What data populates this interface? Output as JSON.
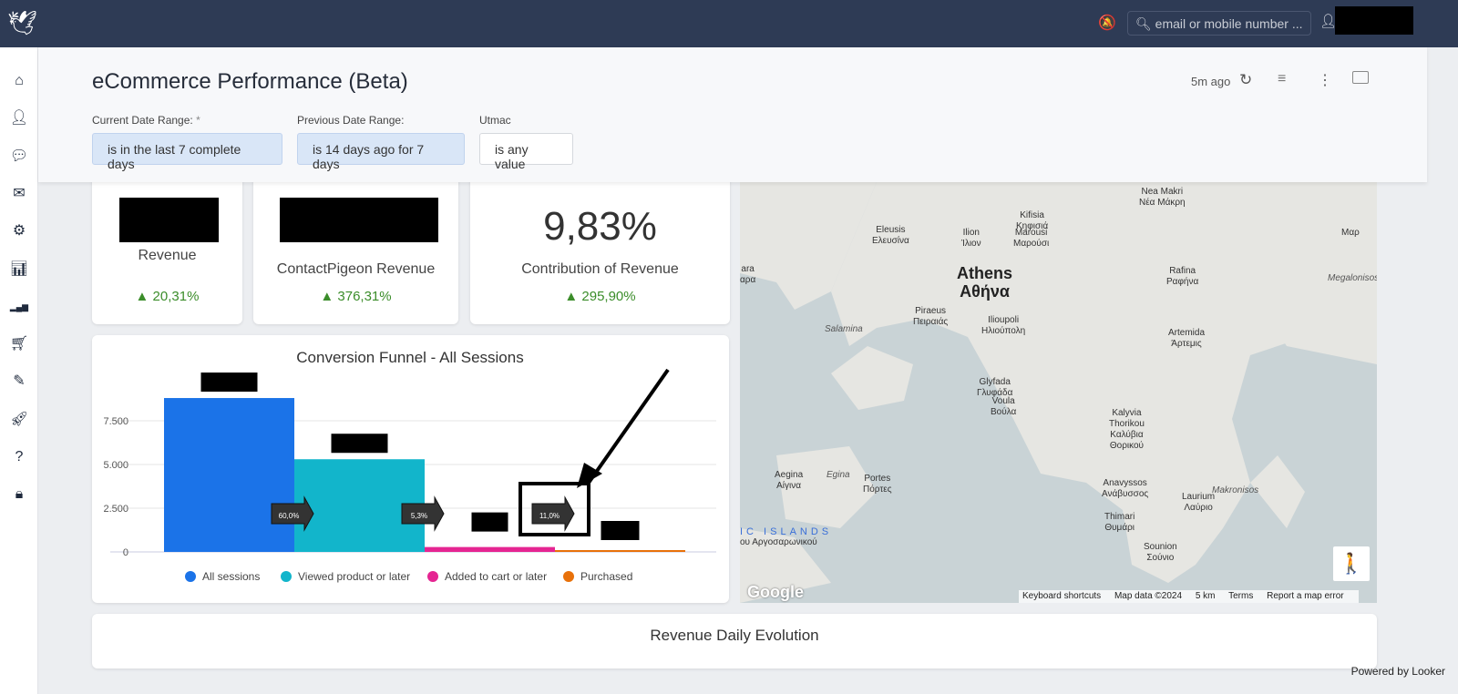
{
  "topbar": {
    "search_placeholder": "email or mobile number ...",
    "icons": [
      "bird-logo",
      "bell-slash-icon",
      "search-icon",
      "user-icon"
    ]
  },
  "sidebar": {
    "items": [
      {
        "icon": "home-icon"
      },
      {
        "icon": "user-icon"
      },
      {
        "icon": "comments-icon"
      },
      {
        "icon": "envelope-icon"
      },
      {
        "icon": "cogs-icon"
      },
      {
        "icon": "bar-chart-icon"
      },
      {
        "icon": "signal-icon"
      },
      {
        "icon": "cart-icon"
      },
      {
        "icon": "edit-icon"
      },
      {
        "icon": "rocket-icon"
      },
      {
        "icon": "help-icon"
      },
      {
        "icon": "lock-icon"
      }
    ]
  },
  "header": {
    "title": "eCommerce Performance (Beta)",
    "updated": "5m ago",
    "filters": [
      {
        "label": "Current Date Range:",
        "required": "*",
        "value": "is in the last 7 complete days"
      },
      {
        "label": "Previous Date Range:",
        "value": "is 14 days ago for 7 days"
      },
      {
        "label": "Utmac",
        "value": "is any value"
      }
    ]
  },
  "kpis": [
    {
      "label": "Revenue",
      "delta": "▲ 20,31%"
    },
    {
      "label": "ContactPigeon Revenue",
      "delta": "▲ 376,31%"
    },
    {
      "value": "9,83%",
      "label": "Contribution of Revenue",
      "delta": "▲ 295,90%"
    }
  ],
  "chart_data": {
    "type": "bar",
    "title": "Conversion Funnel - All Sessions",
    "categories": [
      "All sessions",
      "Viewed product or later",
      "Added to cart or later",
      "Purchased"
    ],
    "values": [
      8800,
      5300,
      280,
      40
    ],
    "colors": [
      "#1b73e8",
      "#12b5cb",
      "#e52592",
      "#e8710a"
    ],
    "step_rates": [
      "60,0%",
      "5,3%",
      "11,0%"
    ],
    "yticks": [
      "0",
      "2.500",
      "5.000",
      "7.500"
    ],
    "ytick_values": [
      0,
      2500,
      5000,
      7500
    ],
    "ylim": [
      0,
      10000
    ],
    "grid": true,
    "legend": "bottom"
  },
  "map": {
    "labels": [
      "Kifisia\nΚηφισιά",
      "Nea Makri\nΝέα Μάκρη",
      "Eleusis\nΕλευσίνα",
      "Ilion\nΊλιον",
      "Marousi\nΜαρούσι",
      "Athens\nΑθήνα",
      "Rafina\nΡαφήνα",
      "Megalonisos",
      "Piraeus\nΠειραιάς",
      "Salamina",
      "Ilioupoli\nΗλιούπολη",
      "Artemida\nΆρτεμις",
      "Glyfada\nΓλυφάδα",
      "Voula\nΒούλα",
      "Kalyvia\nThorikou\nΚαλύβια\nΘορικού",
      "Aegina\nΑίγινα",
      "Egina",
      "Portes\nΠόρτες",
      "Anavyssos\nΑνάβυσσος",
      "Laurium\nΛαύριο",
      "Makronisos",
      "Thimari\nΘυμάρι",
      "Sounion\nΣούνιο",
      "IC ISLANDS",
      "ου Αργοσαρωνικού",
      "ara\nαρα",
      "Μαρ"
    ],
    "footer": {
      "shortcuts": "Keyboard shortcuts",
      "data": "Map data ©2024",
      "scale": "5 km",
      "terms": "Terms",
      "report": "Report a map error"
    },
    "brand": "Google"
  },
  "revenue_card": {
    "title": "Revenue Daily Evolution"
  },
  "footer": {
    "powered": "Powered by",
    "brand": "Looker"
  }
}
